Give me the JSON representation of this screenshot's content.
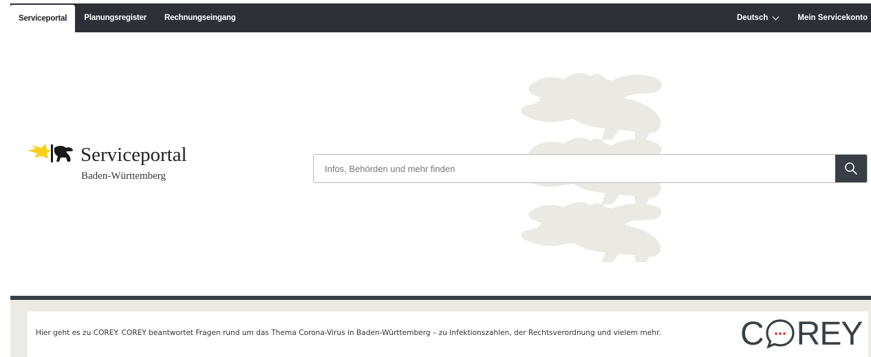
{
  "topnav": {
    "tabs": [
      {
        "label": "Serviceportal",
        "active": true
      },
      {
        "label": "Planungsregister",
        "active": false
      },
      {
        "label": "Rechnungseingang",
        "active": false
      }
    ],
    "language": "Deutsch",
    "account": "Mein Servicekonto"
  },
  "logo": {
    "title": "Serviceportal",
    "subtitle": "Baden-Württemberg",
    "icon": "lion-emblem-icon"
  },
  "search": {
    "placeholder": "Infos, Behörden und mehr finden",
    "button_icon": "search-icon"
  },
  "corey": {
    "text": "Hier geht es zu COREY. COREY beantwortet Fragen rund um das Thema Corona-Virus in Baden-Württemberg – zu Infektionszahlen, der Rechtsverordnung und vielem mehr.",
    "logo_left": "C",
    "logo_right": "REY",
    "logo_icon": "chat-bubble-icon"
  },
  "colors": {
    "nav_bg": "#2d3137",
    "accent_yellow": "#f7d117",
    "lion_bg": "#ebe9e4",
    "band_bg": "#eceae4",
    "corey_red": "#e0262c"
  }
}
